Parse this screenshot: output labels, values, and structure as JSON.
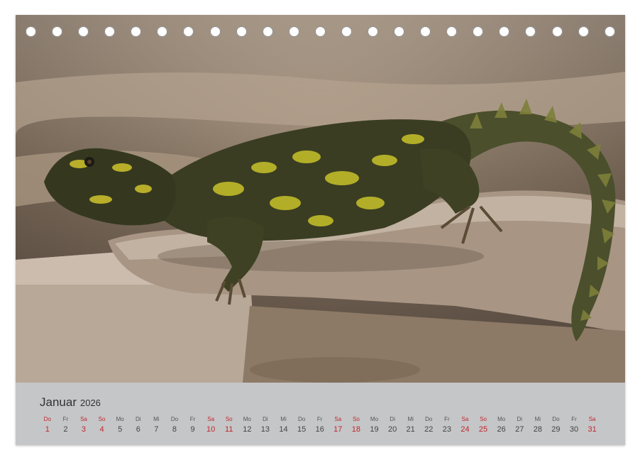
{
  "calendar": {
    "month": "Januar",
    "year": "2026",
    "accent_color": "#c1272d",
    "photo_subject": "Dornschwanzagame auf Fels",
    "binding_hole_count": 23,
    "days": [
      {
        "wd": "Do",
        "d": "1",
        "red": true
      },
      {
        "wd": "Fr",
        "d": "2",
        "red": false
      },
      {
        "wd": "Sa",
        "d": "3",
        "red": true
      },
      {
        "wd": "So",
        "d": "4",
        "red": true
      },
      {
        "wd": "Mo",
        "d": "5",
        "red": false
      },
      {
        "wd": "Di",
        "d": "6",
        "red": false
      },
      {
        "wd": "Mi",
        "d": "7",
        "red": false
      },
      {
        "wd": "Do",
        "d": "8",
        "red": false
      },
      {
        "wd": "Fr",
        "d": "9",
        "red": false
      },
      {
        "wd": "Sa",
        "d": "10",
        "red": true
      },
      {
        "wd": "So",
        "d": "11",
        "red": true
      },
      {
        "wd": "Mo",
        "d": "12",
        "red": false
      },
      {
        "wd": "Di",
        "d": "13",
        "red": false
      },
      {
        "wd": "Mi",
        "d": "14",
        "red": false
      },
      {
        "wd": "Do",
        "d": "15",
        "red": false
      },
      {
        "wd": "Fr",
        "d": "16",
        "red": false
      },
      {
        "wd": "Sa",
        "d": "17",
        "red": true
      },
      {
        "wd": "So",
        "d": "18",
        "red": true
      },
      {
        "wd": "Mo",
        "d": "19",
        "red": false
      },
      {
        "wd": "Di",
        "d": "20",
        "red": false
      },
      {
        "wd": "Mi",
        "d": "21",
        "red": false
      },
      {
        "wd": "Do",
        "d": "22",
        "red": false
      },
      {
        "wd": "Fr",
        "d": "23",
        "red": false
      },
      {
        "wd": "Sa",
        "d": "24",
        "red": true
      },
      {
        "wd": "So",
        "d": "25",
        "red": true
      },
      {
        "wd": "Mo",
        "d": "26",
        "red": false
      },
      {
        "wd": "Di",
        "d": "27",
        "red": false
      },
      {
        "wd": "Mi",
        "d": "28",
        "red": false
      },
      {
        "wd": "Do",
        "d": "29",
        "red": false
      },
      {
        "wd": "Fr",
        "d": "30",
        "red": false
      },
      {
        "wd": "Sa",
        "d": "31",
        "red": true
      }
    ]
  }
}
